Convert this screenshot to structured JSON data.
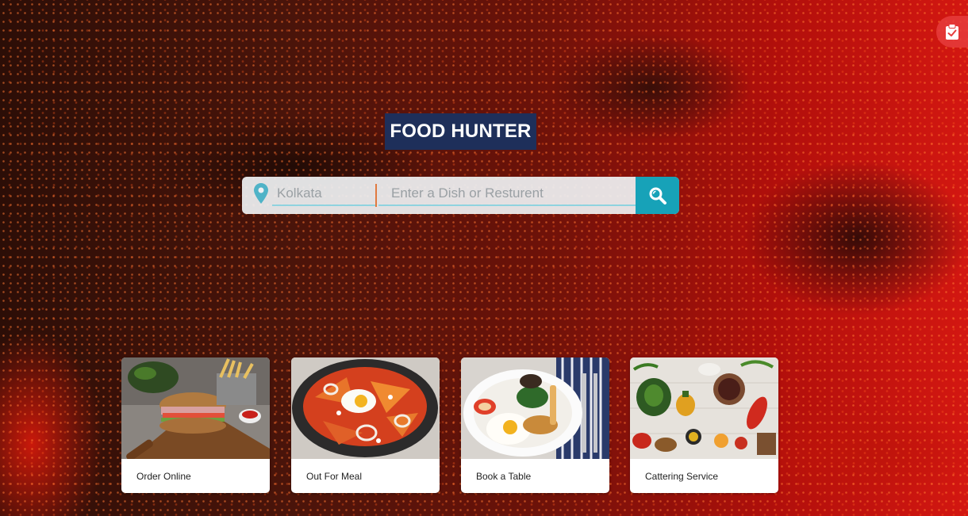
{
  "brand": {
    "title": "FOOD HUNTER"
  },
  "search": {
    "location_placeholder": "Kolkata",
    "dish_placeholder": "Enter a Dish or Resturent"
  },
  "cards": [
    {
      "label": "Order Online"
    },
    {
      "label": "Out For Meal"
    },
    {
      "label": "Book a Table"
    },
    {
      "label": "Cattering Service"
    }
  ],
  "colors": {
    "brand_bg": "#1e2f5a",
    "search_button": "#17a2b8",
    "location_pin": "#4fb3c7",
    "clipboard_button": "#e63c3c"
  },
  "icons": {
    "top_right": "clipboard-check-icon",
    "location": "map-pin-icon",
    "search": "search-icon"
  }
}
